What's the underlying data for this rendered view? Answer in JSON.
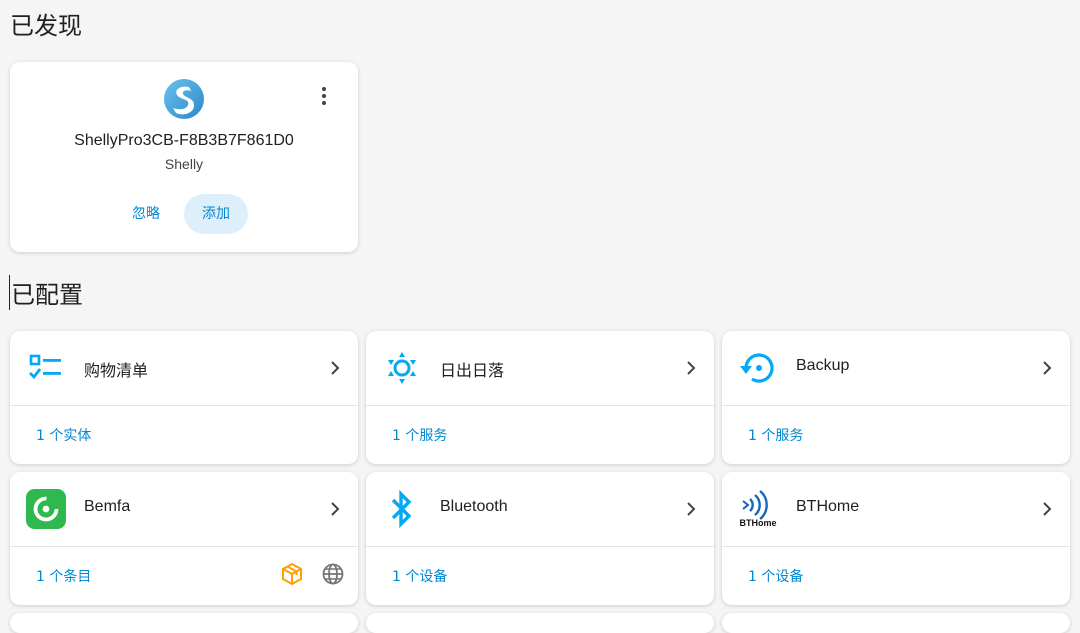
{
  "sections": {
    "discovered_title": "已发现",
    "configured_title": "已配置"
  },
  "discovered": {
    "device_name": "ShellyPro3CB-F8B3B7F861D0",
    "brand": "Shelly",
    "ignore_label": "忽略",
    "add_label": "添加"
  },
  "integrations": [
    {
      "name": "购物清单",
      "footer": "1 个实体",
      "icon": "shopping-list-icon"
    },
    {
      "name": "日出日落",
      "footer": "1 个服务",
      "icon": "sun-icon"
    },
    {
      "name": "Backup",
      "footer": "1 个服务",
      "icon": "backup-restore-icon"
    },
    {
      "name": "Bemfa",
      "footer": "1 个条目",
      "icon": "bemfa-logo-icon",
      "badges": [
        "custom-integration-icon",
        "cloud-globe-icon"
      ]
    },
    {
      "name": "Bluetooth",
      "footer": "1 个设备",
      "icon": "bluetooth-icon"
    },
    {
      "name": "BTHome",
      "footer": "1 个设备",
      "icon": "bthome-logo-icon",
      "logo_text": "BTHome"
    }
  ],
  "colors": {
    "accent": "#0288d1",
    "icon_blue": "#03a9f4",
    "add_bg": "#ddeffa",
    "bemfa_green": "#2fb84f",
    "custom_badge": "#ffa000"
  }
}
